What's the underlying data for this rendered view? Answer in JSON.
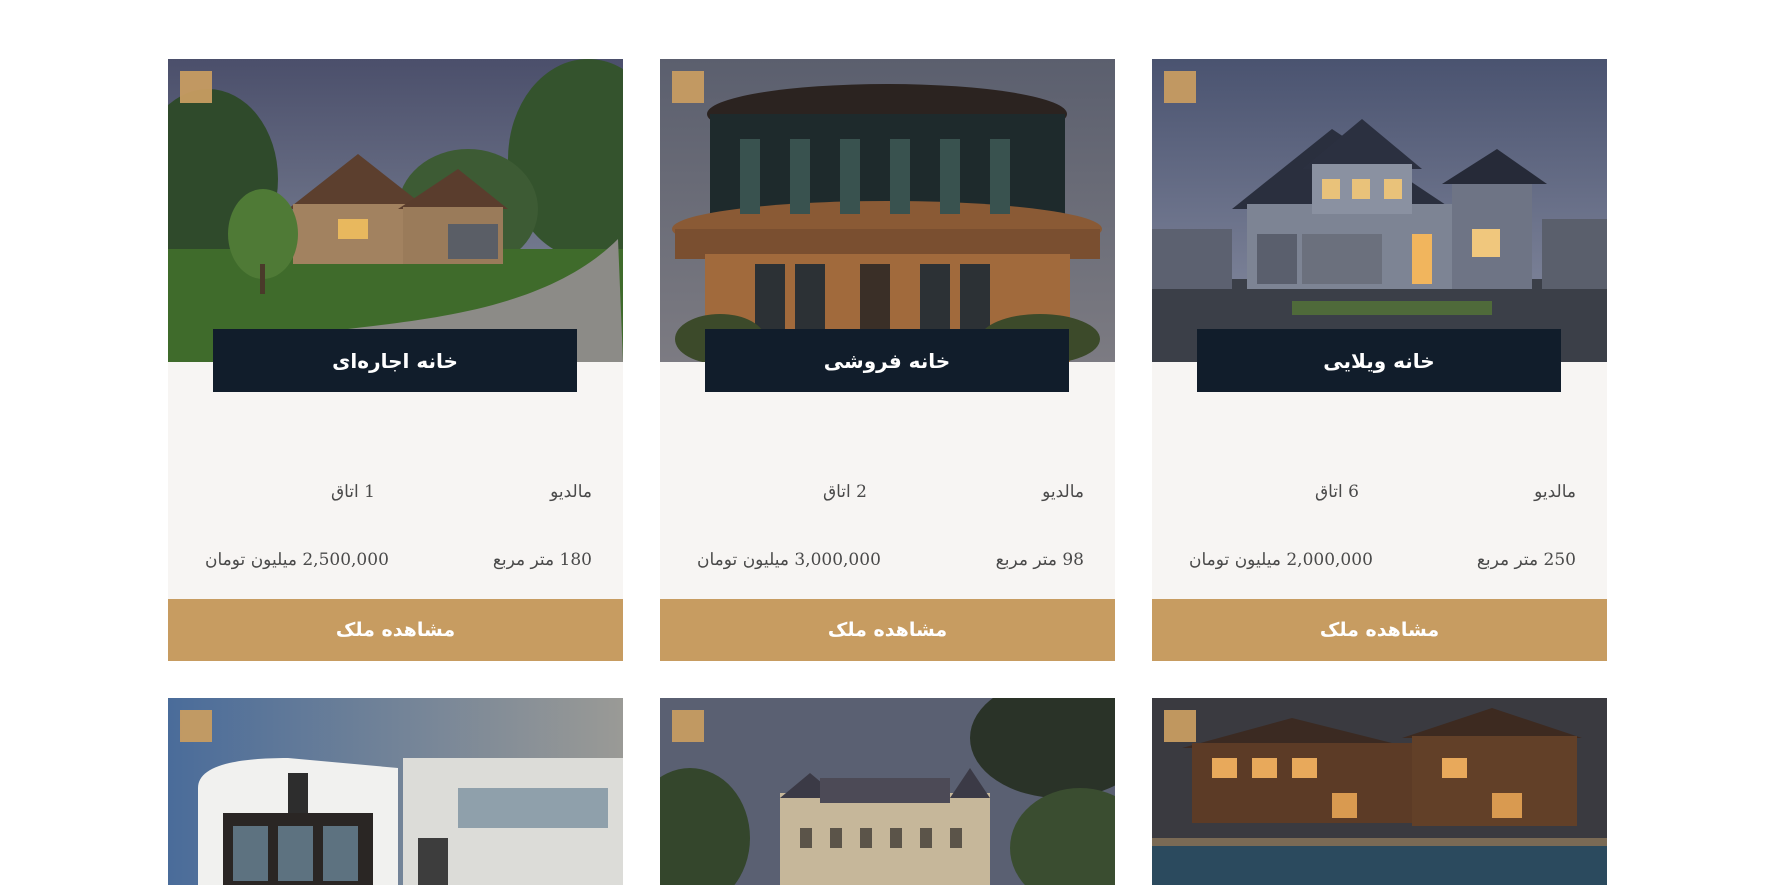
{
  "colors": {
    "accent": "#c79c61",
    "title_bg": "#111d2b",
    "card_bg": "#f7f5f3"
  },
  "cards": [
    {
      "title": "خانه ویلایی",
      "location": "مالدیو",
      "rooms": "6 اتاق",
      "area": "250 متر مربع",
      "price": "2,000,000 میلیون تومان",
      "cta": "مشاهده ملک"
    },
    {
      "title": "خانه فروشی",
      "location": "مالدیو",
      "rooms": "2 اتاق",
      "area": "98 متر مربع",
      "price": "3,000,000 میلیون تومان",
      "cta": "مشاهده ملک"
    },
    {
      "title": "خانه اجاره‌ای",
      "location": "مالدیو",
      "rooms": "1 اتاق",
      "area": "180 متر مربع",
      "price": "2,500,000 میلیون تومان",
      "cta": "مشاهده ملک"
    }
  ]
}
